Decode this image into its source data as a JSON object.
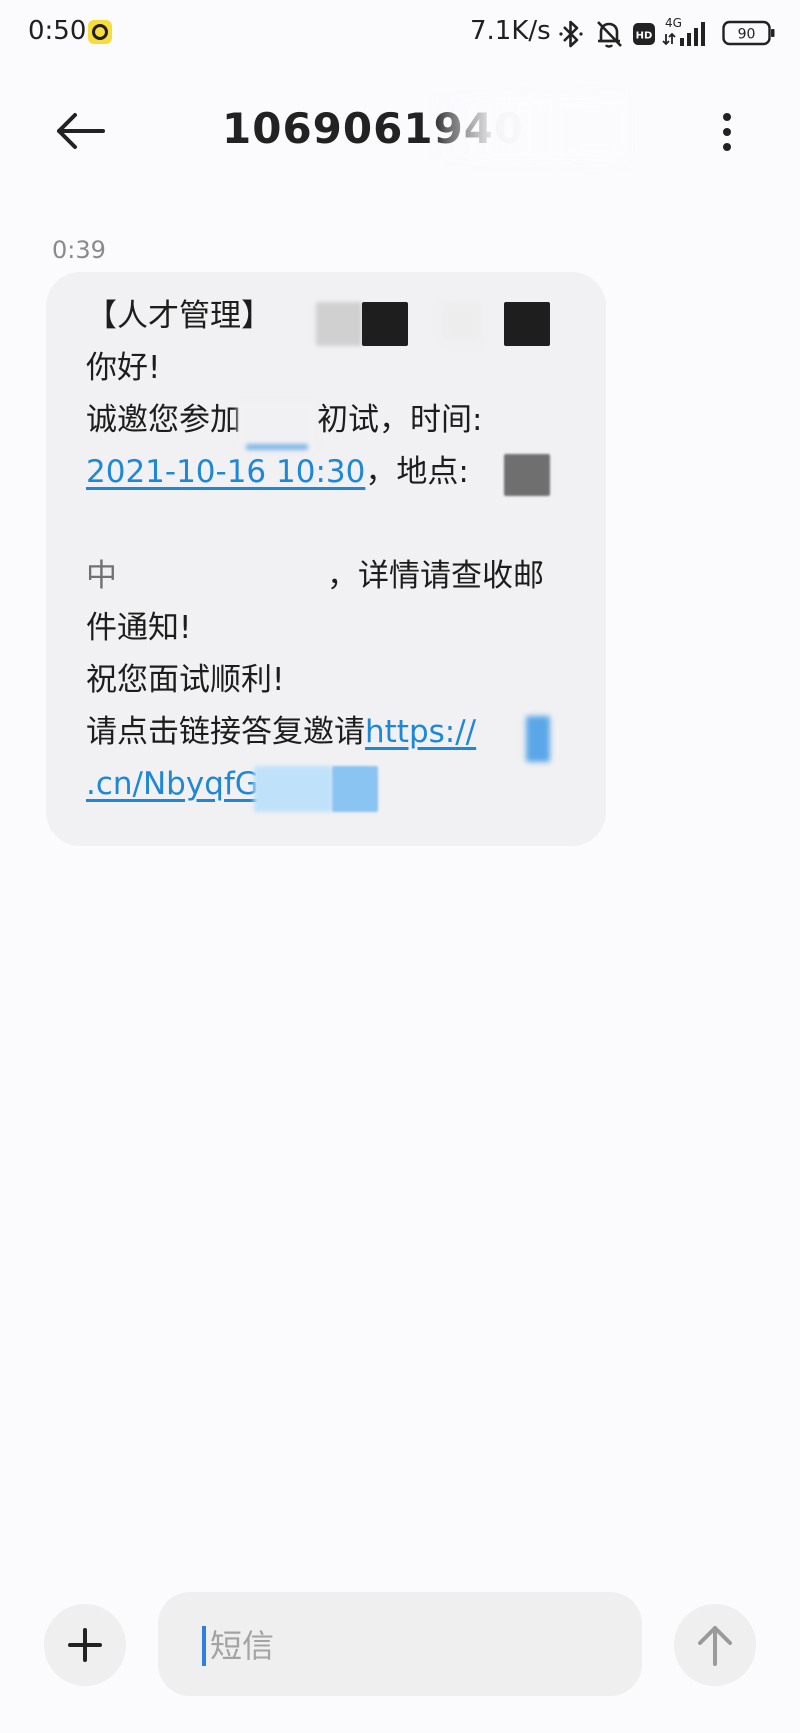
{
  "status_bar": {
    "time": "0:50",
    "net_speed": "7.1K/s",
    "network": "4G",
    "hd_badge": "HD",
    "battery": "90",
    "icons": [
      "notification-app-icon",
      "bluetooth-icon",
      "mute-bell-icon",
      "hd-icon",
      "signal-icon",
      "battery-icon"
    ]
  },
  "header": {
    "title": "106906194",
    "title_partial": "0",
    "icons": [
      "back-arrow-icon",
      "more-vertical-icon"
    ]
  },
  "message": {
    "time": "0:39",
    "lines": {
      "l1": "【人才管理】",
      "l2": "你好!",
      "l3a": "诚邀您参加",
      "l3b": "初试，时间:",
      "l4_link": "2021-10-16 10:30",
      "l4b": "，地点:",
      "l6a": "中",
      "l6b": "，详情请查收邮",
      "l7": "件通知!",
      "l8": "祝您面试顺利!",
      "l9a": "请点击链接答复邀请",
      "l9_link": "https://",
      "l10_link": ".cn/NbyqfG"
    },
    "colors": {
      "bubble": "#f1f1f3",
      "link": "#1e88d7"
    }
  },
  "composer": {
    "placeholder": "短信",
    "icons": [
      "plus-icon",
      "send-arrow-icon"
    ]
  }
}
